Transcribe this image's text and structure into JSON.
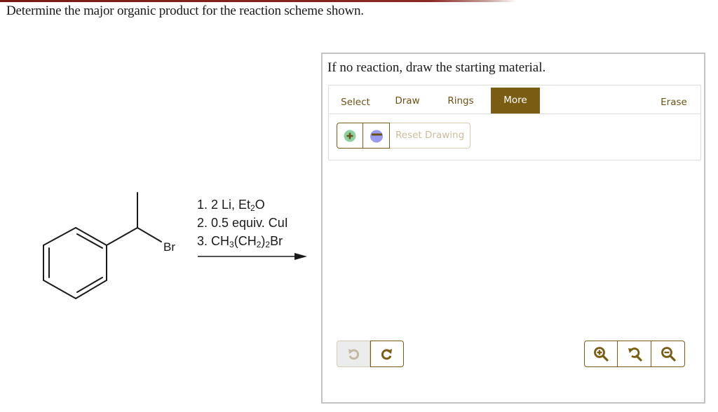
{
  "question": {
    "text": "Determine the major organic product for the reaction scheme shown."
  },
  "reaction": {
    "starting_material": {
      "name": "(1-bromoethyl)benzene",
      "substituent_label": "Br"
    },
    "reagents": [
      {
        "step": "1.",
        "parts": [
          {
            "t": " 2 Li, Et"
          },
          {
            "sub": "2"
          },
          {
            "t": "O"
          }
        ]
      },
      {
        "step": "2.",
        "parts": [
          {
            "t": " 0.5 equiv. CuI"
          }
        ]
      },
      {
        "step": "3.",
        "parts": [
          {
            "t": " CH"
          },
          {
            "sub": "3"
          },
          {
            "t": "(CH"
          },
          {
            "sub": "2"
          },
          {
            "t": ")"
          },
          {
            "sub": "2"
          },
          {
            "t": "Br"
          }
        ]
      }
    ]
  },
  "answer_panel": {
    "instruction": "If no reaction, draw the starting material.",
    "tabs": [
      {
        "label": "Select",
        "active": false
      },
      {
        "label": "Draw",
        "active": false
      },
      {
        "label": "Rings",
        "active": false
      },
      {
        "label": "More",
        "active": true
      },
      {
        "label": "Erase",
        "active": false
      }
    ],
    "subtools": {
      "increase_charge_icon": "plus-circle-icon",
      "decrease_charge_icon": "minus-circle-icon",
      "reset_label": "Reset Drawing"
    },
    "history": {
      "undo_icon": "undo-icon",
      "redo_icon": "redo-icon",
      "undo_enabled": false,
      "redo_enabled": true
    },
    "view_controls": [
      "zoom-in-icon",
      "reset-view-icon",
      "zoom-out-icon"
    ]
  },
  "colors": {
    "accent": "#7a5c12",
    "accent_disabled": "#cbbd9c",
    "plus_green": "#8fd0a0",
    "minus_purple": "#9b9bf0",
    "panel_border": "#c3c3c3",
    "top_band": "#7a1a14"
  }
}
